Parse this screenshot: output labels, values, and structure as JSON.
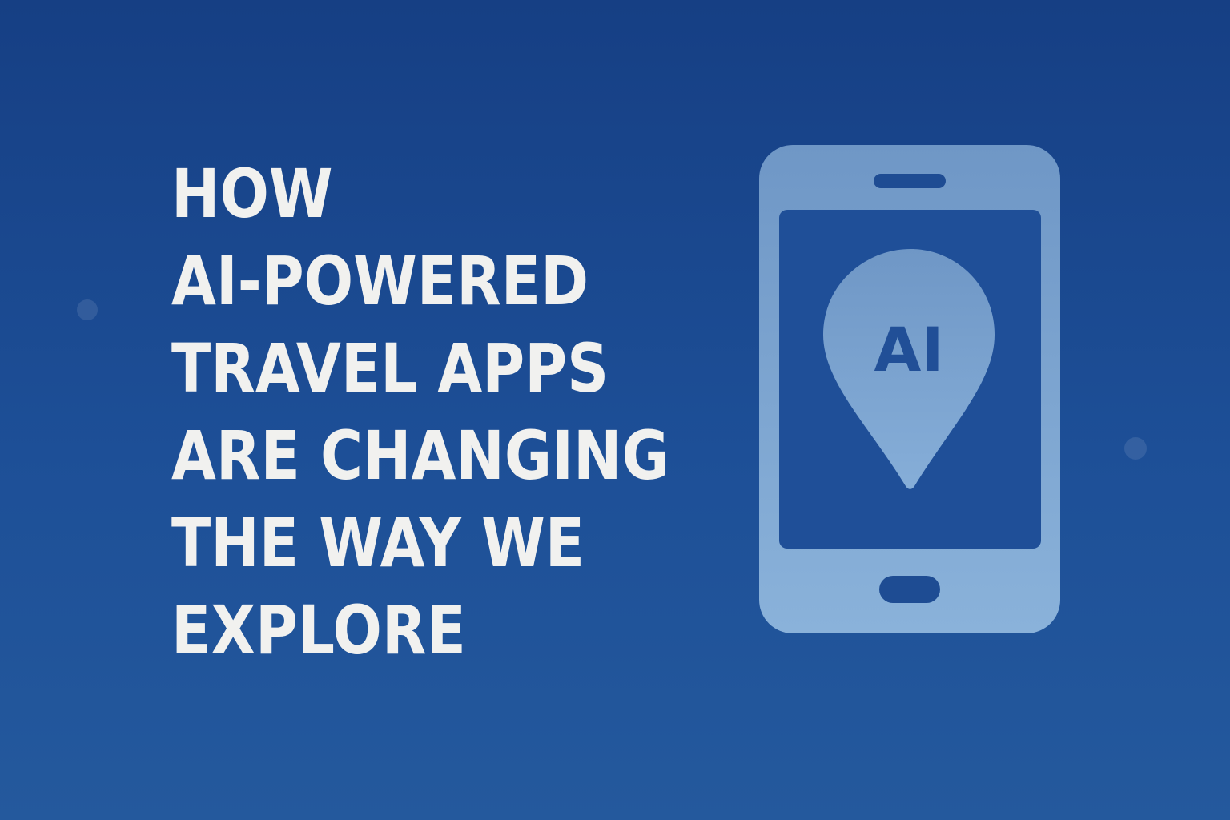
{
  "headline": {
    "lines": [
      "HOW",
      "AI-POWERED",
      "TRAVEL APPS",
      "ARE CHANGING",
      "THE WAY WE",
      "EXPLORE"
    ]
  },
  "illustration": {
    "icon": "smartphone-icon",
    "pin_icon": "map-pin-icon",
    "pin_label": "AI"
  },
  "colors": {
    "background_top": "#163f84",
    "background_bottom": "#24599d",
    "headline_text": "#f1f1ef",
    "phone_fill": "#7ca4d0",
    "screen_fill": "#1f4f98"
  }
}
